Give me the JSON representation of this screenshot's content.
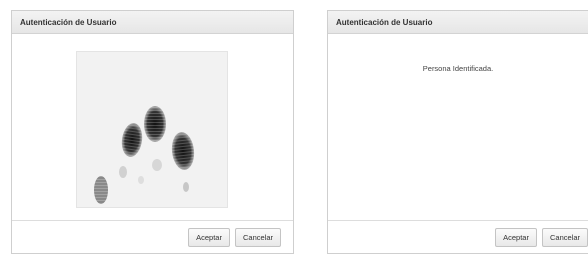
{
  "left_dialog": {
    "title": "Autenticación de Usuario",
    "image_icon": "fingerprint-scan-image",
    "accept_label": "Aceptar",
    "cancel_label": "Cancelar"
  },
  "right_dialog": {
    "title": "Autenticación de Usuario",
    "message": "Persona Identificada.",
    "accept_label": "Aceptar",
    "cancel_label": "Cancelar"
  }
}
